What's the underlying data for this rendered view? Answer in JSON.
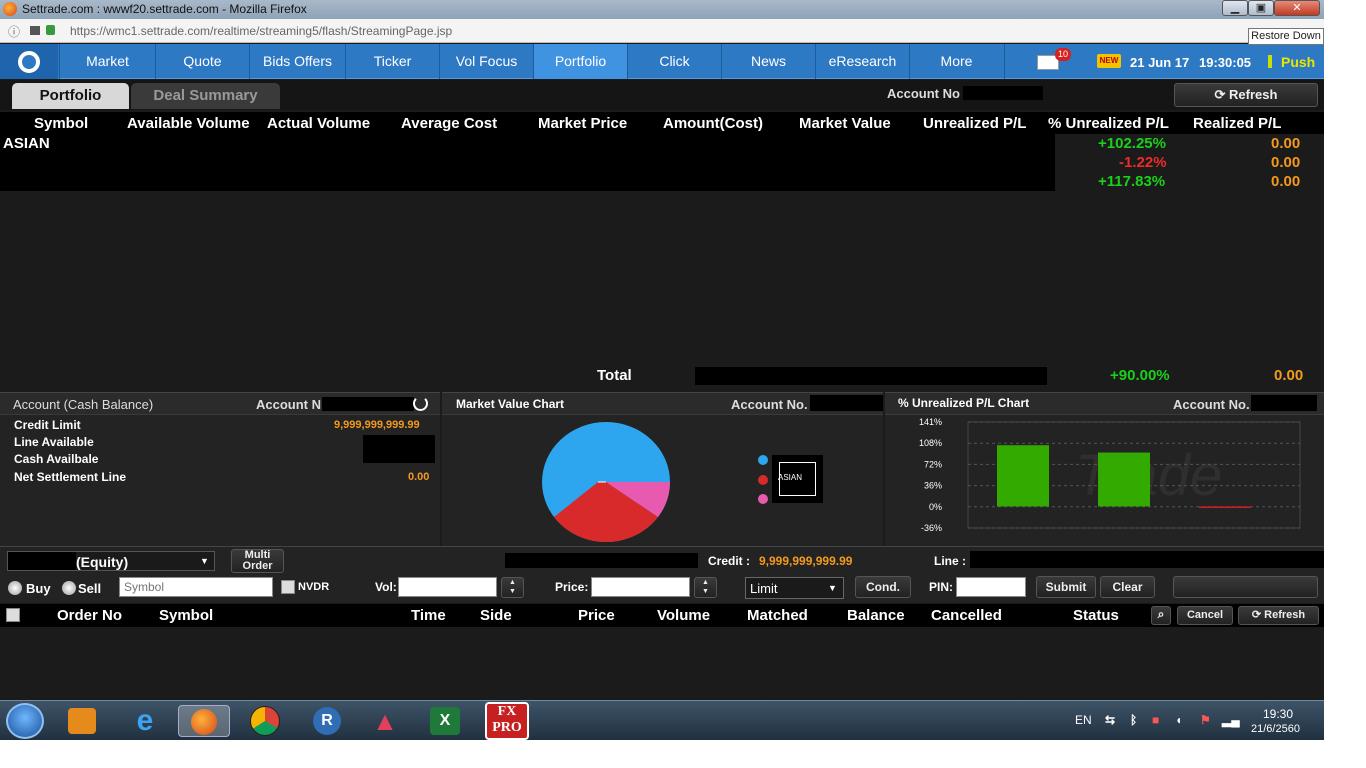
{
  "window": {
    "title": "Settrade.com : wwwf20.settrade.com - Mozilla Firefox",
    "url": "https://wmc1.settrade.com/realtime/streaming5/flash/StreamingPage.jsp",
    "tooltip": "Restore Down",
    "btn_min": "▁",
    "btn_max": "▣",
    "btn_close": "✕"
  },
  "nav": {
    "items": [
      "Market",
      "Quote",
      "Bids Offers",
      "Ticker",
      "Vol Focus",
      "Portfolio",
      "Click",
      "News",
      "eResearch",
      "More"
    ],
    "active": "Portfolio",
    "mail_count": "10",
    "new_badge": "NEW",
    "date": "21 Jun 17",
    "time": "19:30:05",
    "push": "Push"
  },
  "tabs": {
    "portfolio": "Portfolio",
    "deal_summary": "Deal Summary"
  },
  "account_label": "Account No",
  "refresh_label": "Refresh",
  "portfolio": {
    "columns": [
      "Symbol",
      "Available Volume",
      "Actual Volume",
      "Average Cost",
      "Market Price",
      "Amount(Cost)",
      "Market Value",
      "Unrealized P/L",
      "% Unrealized P/L",
      "Realized P/L"
    ],
    "rows": [
      {
        "symbol": "ASIAN",
        "pct": "+102.25%",
        "realized": "0.00"
      },
      {
        "symbol": "",
        "pct": "-1.22%",
        "realized": "0.00"
      },
      {
        "symbol": "",
        "pct": "+117.83%",
        "realized": "0.00"
      }
    ],
    "total_label": "Total",
    "total_pct": "+90.00%",
    "total_realized": "0.00"
  },
  "cash_panel": {
    "title": "Account (Cash Balance)",
    "account_label": "Account N",
    "labels": [
      "Credit Limit",
      "Line Available",
      "Cash Availbale",
      "Net Settlement Line"
    ],
    "credit_limit": "9,999,999,999.99",
    "net_settlement": "0.00"
  },
  "mv_chart": {
    "title": "Market Value Chart",
    "account_label": "Account No.",
    "legend": "ASIAN"
  },
  "chart_data": {
    "type": "bar",
    "title": "% Unrealized P/L Chart",
    "yticks": [
      "141%",
      "108%",
      "72%",
      "36%",
      "0%",
      "-36%"
    ],
    "ylim": [
      -36,
      141
    ],
    "values": [
      102.25,
      90.0,
      -1.22
    ],
    "colors": [
      "#33aa00",
      "#33aa00",
      "#cc2222"
    ]
  },
  "pl_chart": {
    "account_label": "Account No.",
    "watermark": "Trade"
  },
  "order": {
    "account_suffix": "(Equity)",
    "multi_order": "Multi Order",
    "credit_label": "Credit :",
    "credit_value": "9,999,999,999.99",
    "line_label": "Line :",
    "buy": "Buy",
    "sell": "Sell",
    "symbol_placeholder": "Symbol",
    "nvdr": "NVDR",
    "vol": "Vol:",
    "price": "Price:",
    "limit": "Limit",
    "cond": "Cond.",
    "pin": "PIN:",
    "submit": "Submit",
    "clear": "Clear"
  },
  "orders": {
    "columns": [
      "Order No",
      "Symbol",
      "Time",
      "Side",
      "Price",
      "Volume",
      "Matched",
      "Balance",
      "Cancelled",
      "Status"
    ],
    "cancel": "Cancel",
    "refresh": "Refresh"
  },
  "taskbar": {
    "lang": "EN",
    "time": "19:30",
    "date": "21/6/2560"
  }
}
